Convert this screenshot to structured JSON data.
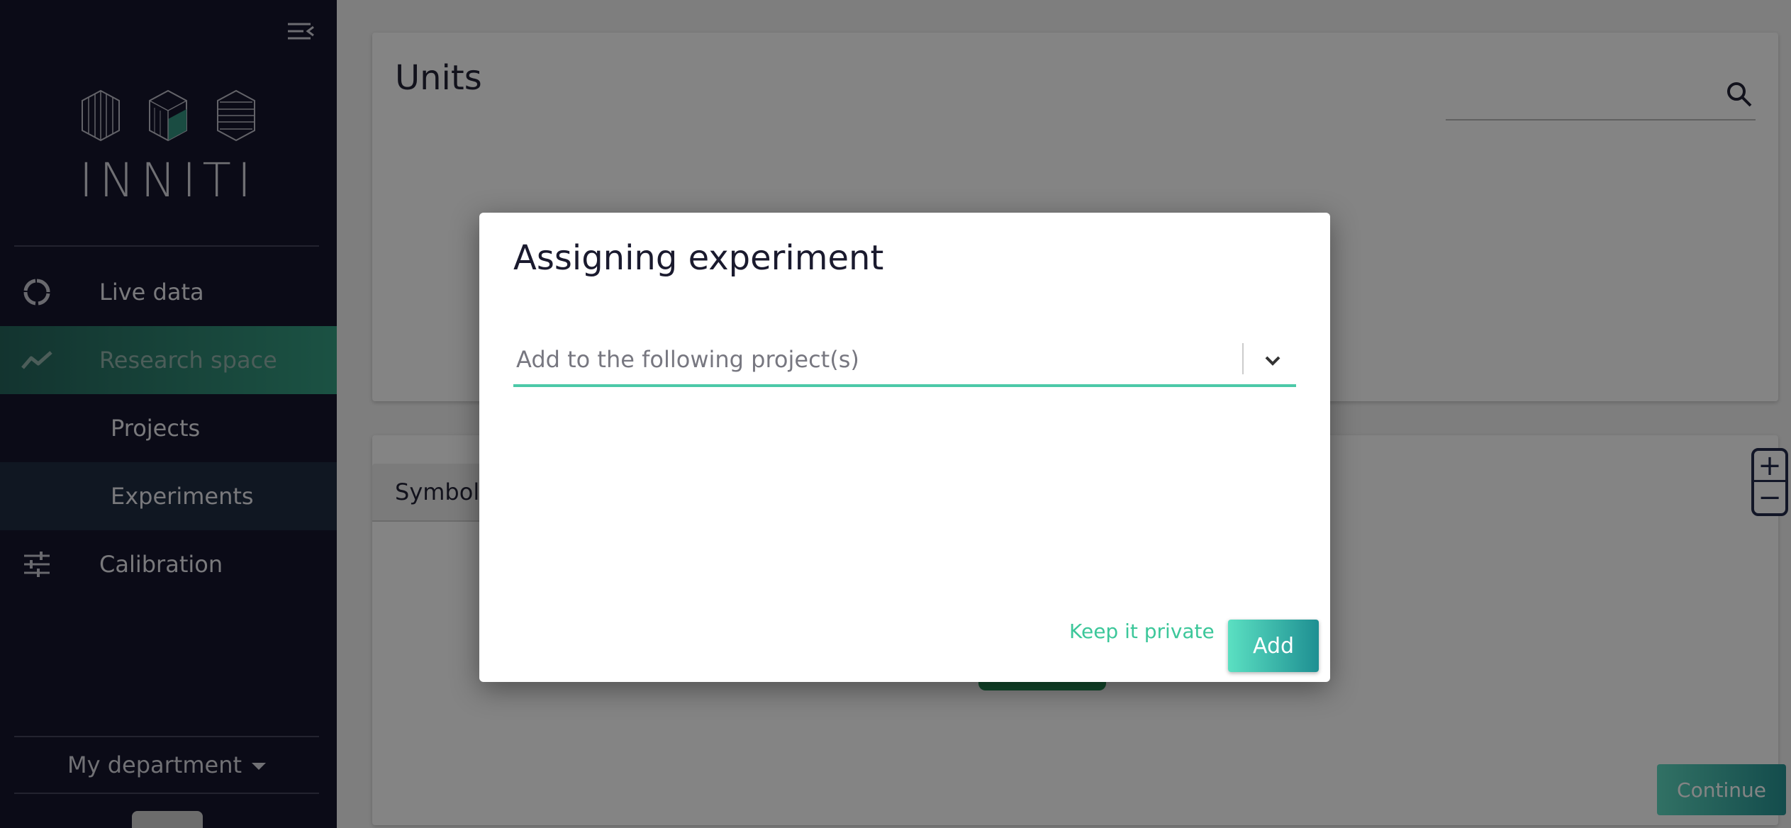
{
  "sidebar": {
    "collapse_icon": "menu-collapse-icon",
    "logo_text": "INNITI",
    "nav": [
      {
        "label": "Live data",
        "icon": "circle-loading-icon"
      },
      {
        "label": "Research space",
        "icon": "trending-line-icon"
      },
      {
        "label": "Projects"
      },
      {
        "label": "Experiments"
      },
      {
        "label": "Calibration",
        "icon": "sliders-icon"
      }
    ],
    "department": "My department"
  },
  "main": {
    "units_card": {
      "title": "Units",
      "search_placeholder": ""
    },
    "symbols_card": {
      "tab_label": "Symbols",
      "zoom_in_label": "+",
      "zoom_out_label": "−",
      "continue_label": "Continue"
    }
  },
  "modal": {
    "title": "Assigning experiment",
    "select_placeholder": "Add to the following project(s)",
    "keep_private_label": "Keep it private",
    "add_label": "Add"
  },
  "colors": {
    "sidebar_bg": "#0d0d24",
    "accent": "#4cc9a8",
    "active_gradient_start": "#1c5e55",
    "active_gradient_end": "#2d9a7d"
  }
}
